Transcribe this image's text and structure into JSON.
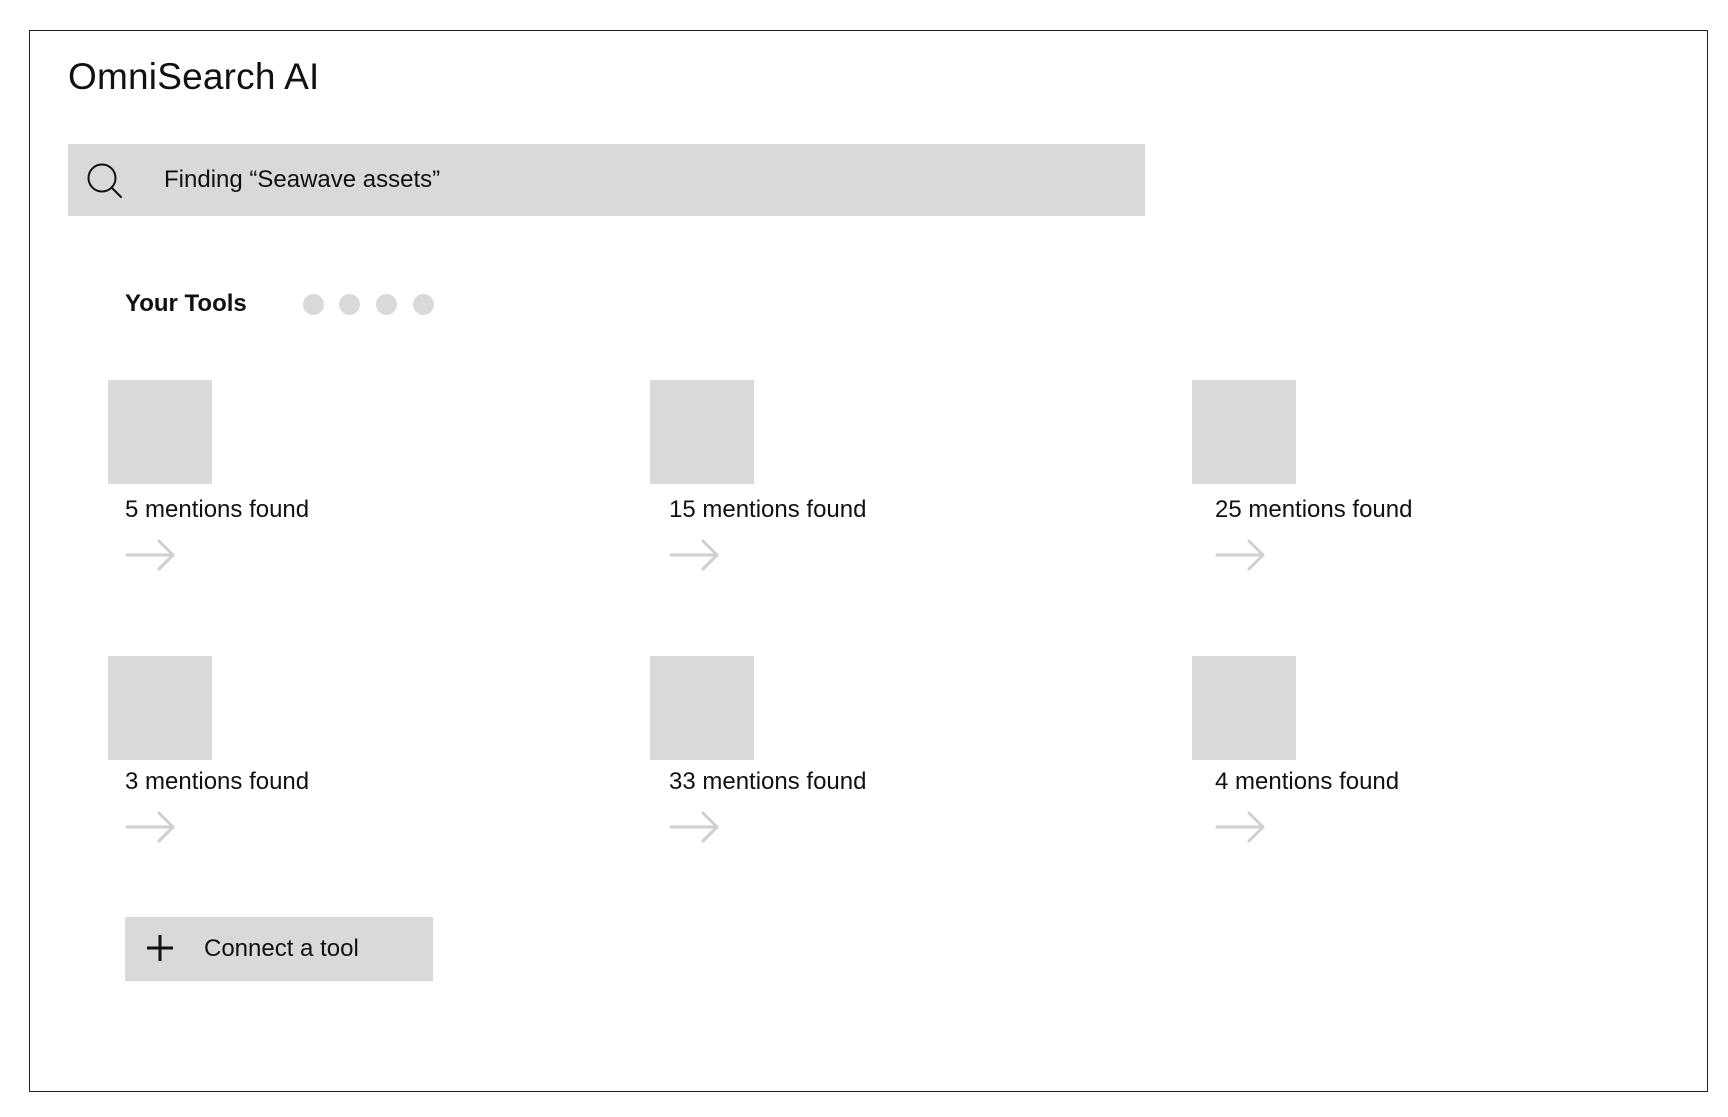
{
  "app": {
    "title": "OmniSearch AI"
  },
  "search": {
    "icon": "search-icon",
    "text": "Finding “Seawave assets”"
  },
  "tools_section": {
    "title": "Your Tools",
    "pager_dots": 4,
    "cards": [
      {
        "count_label": "5 mentions found",
        "arrow_icon": "arrow-right-icon"
      },
      {
        "count_label": "15 mentions found",
        "arrow_icon": "arrow-right-icon"
      },
      {
        "count_label": "25 mentions found",
        "arrow_icon": "arrow-right-icon"
      },
      {
        "count_label": "3 mentions found",
        "arrow_icon": "arrow-right-icon"
      },
      {
        "count_label": "33 mentions found",
        "arrow_icon": "arrow-right-icon"
      },
      {
        "count_label": "4 mentions found",
        "arrow_icon": "arrow-right-icon"
      }
    ]
  },
  "connect_button": {
    "label": "Connect a tool",
    "icon": "plus-icon"
  },
  "colors": {
    "placeholder_fill": "#d9d9d9",
    "arrow": "#cfcfcf",
    "frame_border": "#222222",
    "text": "#111111"
  }
}
